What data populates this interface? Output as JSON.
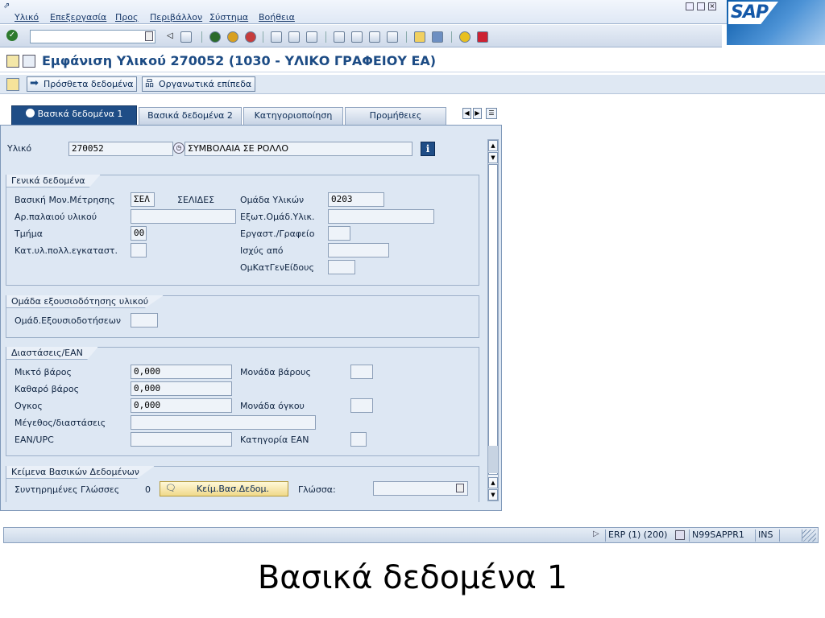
{
  "menu": [
    "Υλικό",
    "Επεξεργασία",
    "Προς",
    "Περιβάλλον",
    "Σύστημα",
    "Βοήθεια"
  ],
  "brand": {
    "logo_text": "SAP"
  },
  "title": "Εμφάνιση Υλικού 270052 (1030 - ΥΛΙΚΟ ΓΡΑΦΕΙΟΥ ΕΑ)",
  "app_toolbar": {
    "more_data": "Πρόσθετα δεδομένα",
    "org_levels": "Οργανωτικά επίπεδα"
  },
  "tabs": [
    "Βασικά δεδομένα 1",
    "Βασικά δεδομένα 2",
    "Κατηγοριοποίηση",
    "Προμήθειες"
  ],
  "material": {
    "label": "Υλικό",
    "number": "270052",
    "description": "ΣΥΜΒΟΛΑΙΑ ΣΕ ΡΟΛΛΟ"
  },
  "general": {
    "title": "Γενικά δεδομένα",
    "base_uom_label": "Βασική Μον.Μέτρησης",
    "base_uom": "ΣΕΛ",
    "base_uom_text": "ΣΕΛΙΔΕΣ",
    "mat_group_label": "Ομάδα Υλικών",
    "mat_group": "0203",
    "old_mat_label": "Αρ.παλαιού υλικού",
    "old_mat": "",
    "ext_group_label": "Εξωτ.Ομάδ.Υλικ.",
    "ext_group": "",
    "division_label": "Τμήμα",
    "division": "00",
    "lab_label": "Εργαστ./Γραφείο",
    "lab": "",
    "x_plant_label": "Κατ.υλ.πολλ.εγκαταστ.",
    "x_plant": "",
    "valid_from_label": "Ισχύς από",
    "valid_from": "",
    "gen_item_label": "ΟμΚατΓενΕίδους",
    "gen_item": ""
  },
  "auth": {
    "title": "Ομάδα εξουσιοδότησης υλικού",
    "label": "Ομάδ.Εξουσιοδοτήσεων",
    "value": ""
  },
  "dims": {
    "title": "Διαστάσεις/EAN",
    "gross_label": "Μικτό βάρος",
    "gross": "0,000",
    "weight_unit_label": "Μονάδα βάρους",
    "weight_unit": "",
    "net_label": "Καθαρό βάρος",
    "net": "0,000",
    "volume_label": "Ογκος",
    "volume": "0,000",
    "volume_unit_label": "Μονάδα όγκου",
    "volume_unit": "",
    "size_label": "Μέγεθος/διαστάσεις",
    "size": "",
    "ean_label": "EAN/UPC",
    "ean": "",
    "ean_cat_label": "Κατηγορία EAN",
    "ean_cat": ""
  },
  "texts": {
    "title": "Κείμενα Βασικών Δεδομένων",
    "langs_label": "Συντηρημένες Γλώσσες",
    "langs_count": "0",
    "button": "Κείμ.Βασ.Δεδομ.",
    "lang_label": "Γλώσσα:",
    "lang": ""
  },
  "status": {
    "system": "ERP (1) (200)",
    "server": "N99SAPPR1",
    "mode": "INS"
  },
  "caption": "Βασικά δεδομένα 1",
  "colors": {
    "accent": "#1f4d86",
    "panel": "#dde7f3",
    "title": "#1c4b84"
  }
}
